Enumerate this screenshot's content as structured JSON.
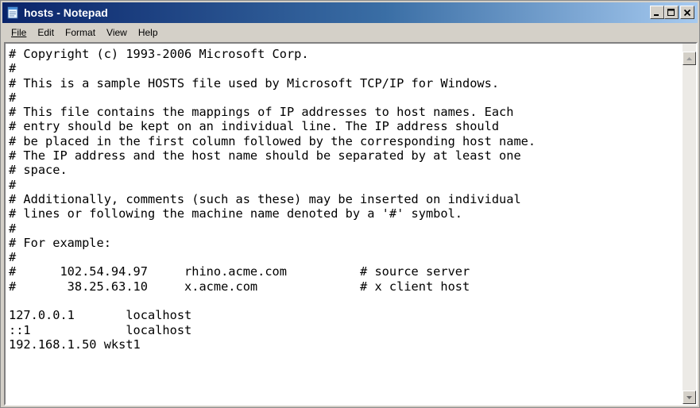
{
  "window": {
    "title": "hosts - Notepad"
  },
  "menu": {
    "items": [
      {
        "label": "File"
      },
      {
        "label": "Edit"
      },
      {
        "label": "Format"
      },
      {
        "label": "View"
      },
      {
        "label": "Help"
      }
    ]
  },
  "editor": {
    "lines": [
      "# Copyright (c) 1993-2006 Microsoft Corp.",
      "#",
      "# This is a sample HOSTS file used by Microsoft TCP/IP for Windows.",
      "#",
      "# This file contains the mappings of IP addresses to host names. Each",
      "# entry should be kept on an individual line. The IP address should",
      "# be placed in the first column followed by the corresponding host name.",
      "# The IP address and the host name should be separated by at least one",
      "# space.",
      "#",
      "# Additionally, comments (such as these) may be inserted on individual",
      "# lines or following the machine name denoted by a '#' symbol.",
      "#",
      "# For example:",
      "#",
      "#      102.54.94.97     rhino.acme.com          # source server",
      "#       38.25.63.10     x.acme.com              # x client host",
      "",
      "127.0.0.1       localhost",
      "::1             localhost",
      "192.168.1.50 wkst1"
    ]
  },
  "icons": {
    "app": "notepad-icon",
    "minimize": "minimize-icon",
    "maximize": "maximize-icon",
    "close": "close-icon",
    "scroll_up": "scroll-up-arrow-icon",
    "scroll_down": "scroll-down-arrow-icon"
  }
}
